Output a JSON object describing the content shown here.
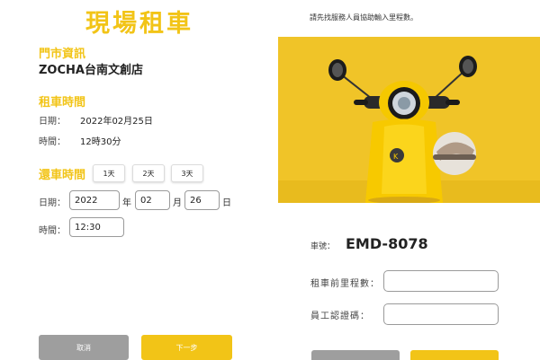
{
  "colors": {
    "accent": "#f2c417",
    "cancel_gray": "#9e9e9e",
    "photo_bg": "#f0c428"
  },
  "left": {
    "title": "現場租車",
    "store_section": "門市資訊",
    "store_name": "ZOCHA台南文創店",
    "rent_section": "租車時間",
    "rent_date_label": "日期：",
    "rent_date_value": "2022年02月25日",
    "rent_time_label": "時間：",
    "rent_time_value": "12時30分",
    "return_section": "還車時間",
    "day_buttons": [
      "1天",
      "2天",
      "3天"
    ],
    "return_date_label": "日期：",
    "return_year": "2022",
    "return_year_unit": "年",
    "return_month": "02",
    "return_month_unit": "月",
    "return_day": "26",
    "return_day_unit": "日",
    "return_time_label": "時間：",
    "return_time": "12:30",
    "cancel_label": "取消",
    "next_label": "下一步"
  },
  "right": {
    "hint": "請先找服務人員協助輸入里程數。",
    "photo_icon": "yellow-scooter-photo",
    "plate_label": "車號：",
    "plate_value": "EMD-8078",
    "mileage_label": "租車前里程數：",
    "staff_code_label": "員工認證碼："
  }
}
